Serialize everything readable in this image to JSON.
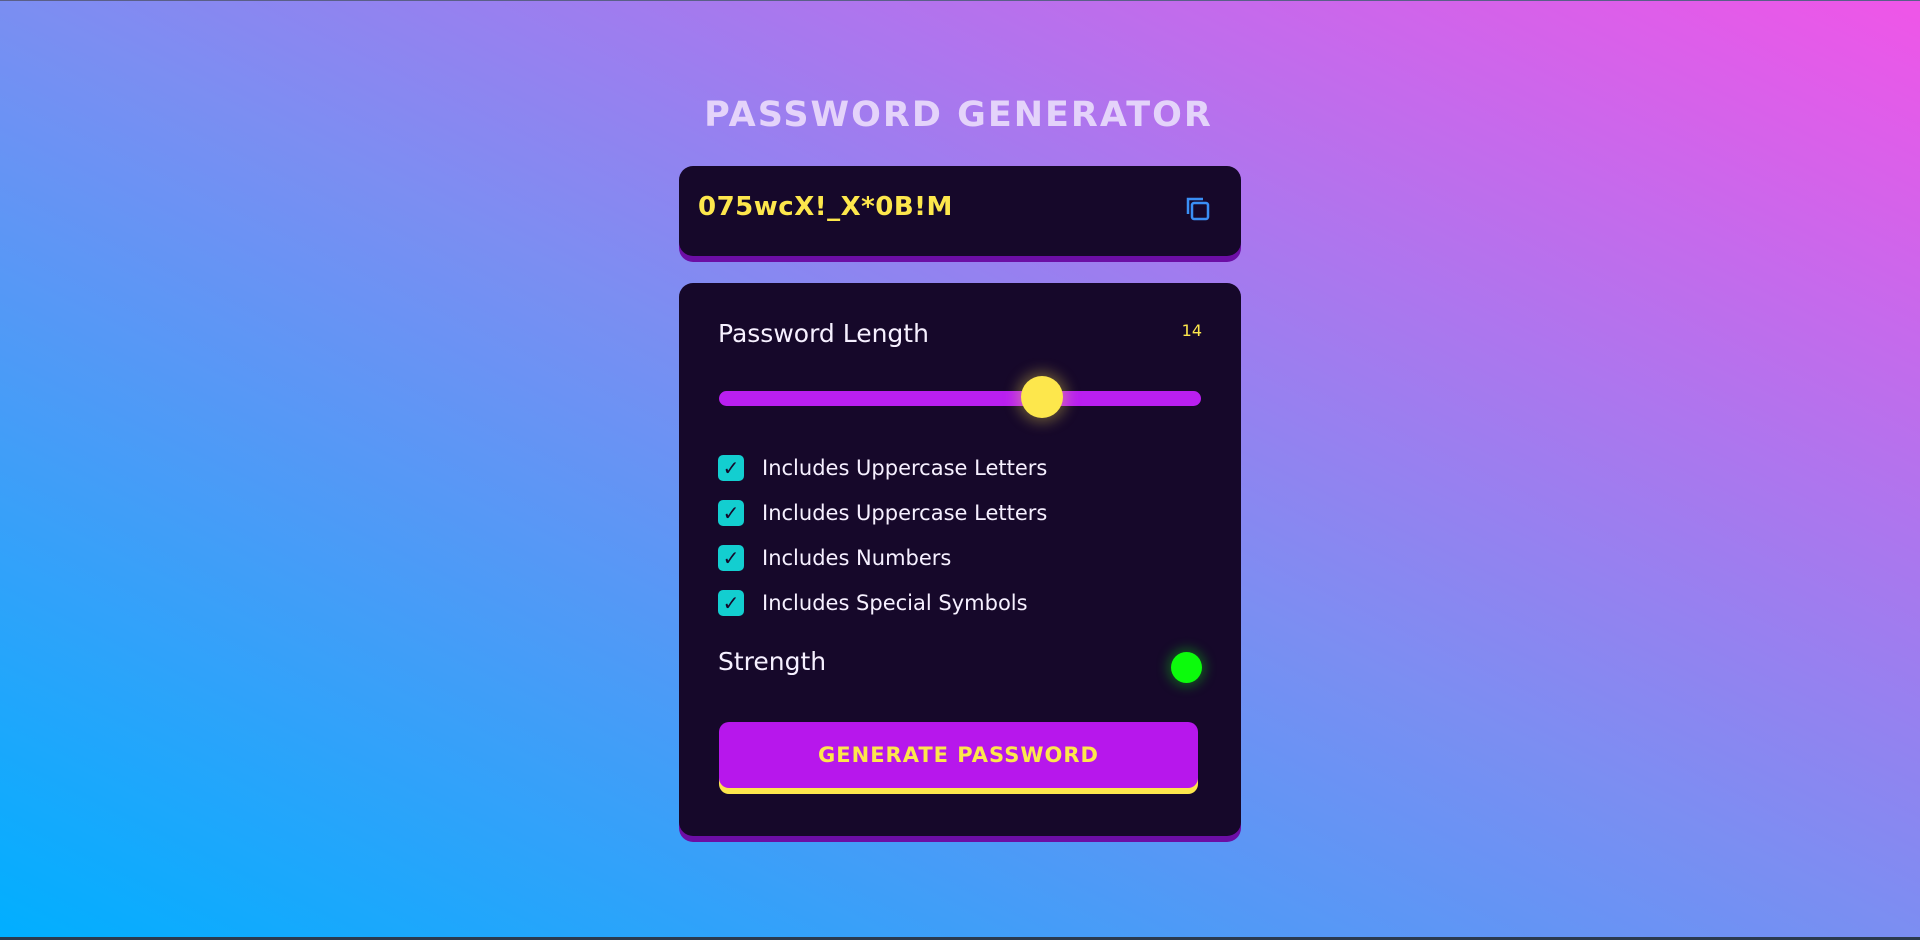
{
  "app": {
    "title": "PASSWORD GENERATOR"
  },
  "display": {
    "password": "075wcX!_X*0B!M",
    "copy_icon": "copy-icon"
  },
  "length": {
    "label": "Password Length",
    "value": "14",
    "slider_fraction": 0.67
  },
  "options": [
    {
      "label": "Includes Uppercase Letters",
      "checked": true
    },
    {
      "label": "Includes Uppercase Letters",
      "checked": true
    },
    {
      "label": "Includes Numbers",
      "checked": true
    },
    {
      "label": "Includes Special Symbols",
      "checked": true
    }
  ],
  "check_glyph": "✓",
  "strength": {
    "label": "Strength",
    "indicator_color": "#0cfb0c"
  },
  "generate": {
    "label": "GENERATE PASSWORD"
  },
  "colors": {
    "card_bg": "#16082a",
    "accent_yellow": "#fde74c",
    "accent_purple": "#b717ec",
    "checkbox": "#13ced0"
  }
}
